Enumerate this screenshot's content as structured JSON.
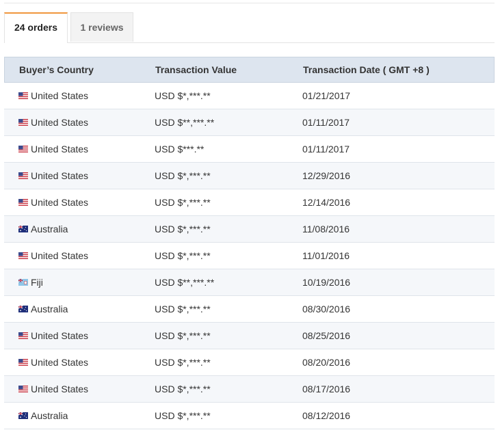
{
  "tabs": {
    "orders_label": "24 orders",
    "reviews_label": "1 reviews",
    "active": "orders",
    "accent_color": "#f0963c"
  },
  "table": {
    "headers": {
      "country": "Buyer’s Country",
      "value": "Transaction Value",
      "date": "Transaction Date ( GMT +8 )"
    },
    "rows": [
      {
        "flag": "us-flag-icon",
        "country": "United States",
        "value": "USD $*,***.**",
        "date": "01/21/2017"
      },
      {
        "flag": "us-flag-icon",
        "country": "United States",
        "value": "USD $**,***.**",
        "date": "01/11/2017"
      },
      {
        "flag": "us-flag-icon",
        "country": "United States",
        "value": "USD $***.**",
        "date": "01/11/2017"
      },
      {
        "flag": "us-flag-icon",
        "country": "United States",
        "value": "USD $*,***.**",
        "date": "12/29/2016"
      },
      {
        "flag": "us-flag-icon",
        "country": "United States",
        "value": "USD $*,***.**",
        "date": "12/14/2016"
      },
      {
        "flag": "au-flag-icon",
        "country": "Australia",
        "value": "USD $*,***.**",
        "date": "11/08/2016"
      },
      {
        "flag": "us-flag-icon",
        "country": "United States",
        "value": "USD $*,***.**",
        "date": "11/01/2016"
      },
      {
        "flag": "fj-flag-icon",
        "country": "Fiji",
        "value": "USD $**,***.**",
        "date": "10/19/2016"
      },
      {
        "flag": "au-flag-icon",
        "country": "Australia",
        "value": "USD $*,***.**",
        "date": "08/30/2016"
      },
      {
        "flag": "us-flag-icon",
        "country": "United States",
        "value": "USD $*,***.**",
        "date": "08/25/2016"
      },
      {
        "flag": "us-flag-icon",
        "country": "United States",
        "value": "USD $*,***.**",
        "date": "08/20/2016"
      },
      {
        "flag": "us-flag-icon",
        "country": "United States",
        "value": "USD $*,***.**",
        "date": "08/17/2016"
      },
      {
        "flag": "au-flag-icon",
        "country": "Australia",
        "value": "USD $*,***.**",
        "date": "08/12/2016"
      }
    ]
  }
}
